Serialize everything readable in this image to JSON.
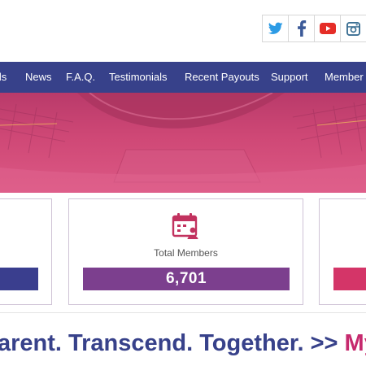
{
  "social": {
    "icons": [
      "twitter-icon",
      "facebook-icon",
      "youtube-icon",
      "instagram-icon"
    ],
    "colors": {
      "twitter": "#2c9be5",
      "facebook": "#3b5998",
      "youtube": "#e52d27",
      "instagram": "#3a6f93"
    }
  },
  "nav": {
    "items": [
      "ils",
      "News",
      "F.A.Q.",
      "Testimonials",
      "Recent Payouts",
      "Support",
      "Member"
    ]
  },
  "stats": {
    "center": {
      "label": "Total Members",
      "value": "6,701"
    }
  },
  "tagline": {
    "main": "arent. Transcend. Together. >> ",
    "accent": "MyPa"
  },
  "colors": {
    "nav_bg": "#37418a",
    "hero": "#cf4876",
    "bar_left": "#3a3e8e",
    "bar_center": "#7c3f8e",
    "bar_right": "#d43568",
    "tagline_main": "#37418a",
    "tagline_accent": "#c62a6e"
  }
}
